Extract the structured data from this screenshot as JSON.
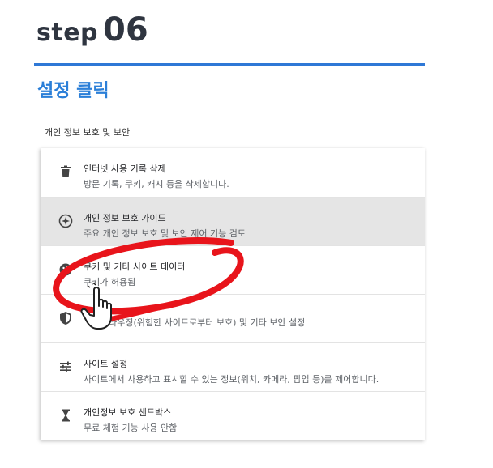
{
  "step": {
    "word": "step",
    "number": "06",
    "subtitle": "설정 클릭"
  },
  "section_title": "개인 정보 보호 및 보안",
  "items": [
    {
      "title": "인터넷 사용 기록 삭제",
      "desc": "방문 기록, 쿠키, 캐시 등을 삭제합니다.",
      "icon": "trash-icon"
    },
    {
      "title": "개인 정보 보호 가이드",
      "desc": "주요 개인 정보 보호 및 보안 제어 기능 검토",
      "icon": "compass-icon"
    },
    {
      "title": "쿠키 및 기타 사이트 데이터",
      "desc": "쿠키가 허용됨",
      "icon": "cookie-icon"
    },
    {
      "title": "",
      "desc": "브라우징(위험한 사이트로부터 보호) 및 기타 보안 설정",
      "icon": "shield-icon"
    },
    {
      "title": "사이트 설정",
      "desc": "사이트에서 사용하고 표시할 수 있는 정보(위치, 카메라, 팝업 등)를 제어합니다.",
      "icon": "sliders-icon"
    },
    {
      "title": "개인정보 보호 샌드박스",
      "desc": "무료 체험 기능 사용 안함",
      "icon": "flask-icon"
    }
  ],
  "colors": {
    "accent_blue": "#2b7fd8",
    "annotation_red": "#e8141b",
    "highlight_row": "#e5e5e5"
  }
}
